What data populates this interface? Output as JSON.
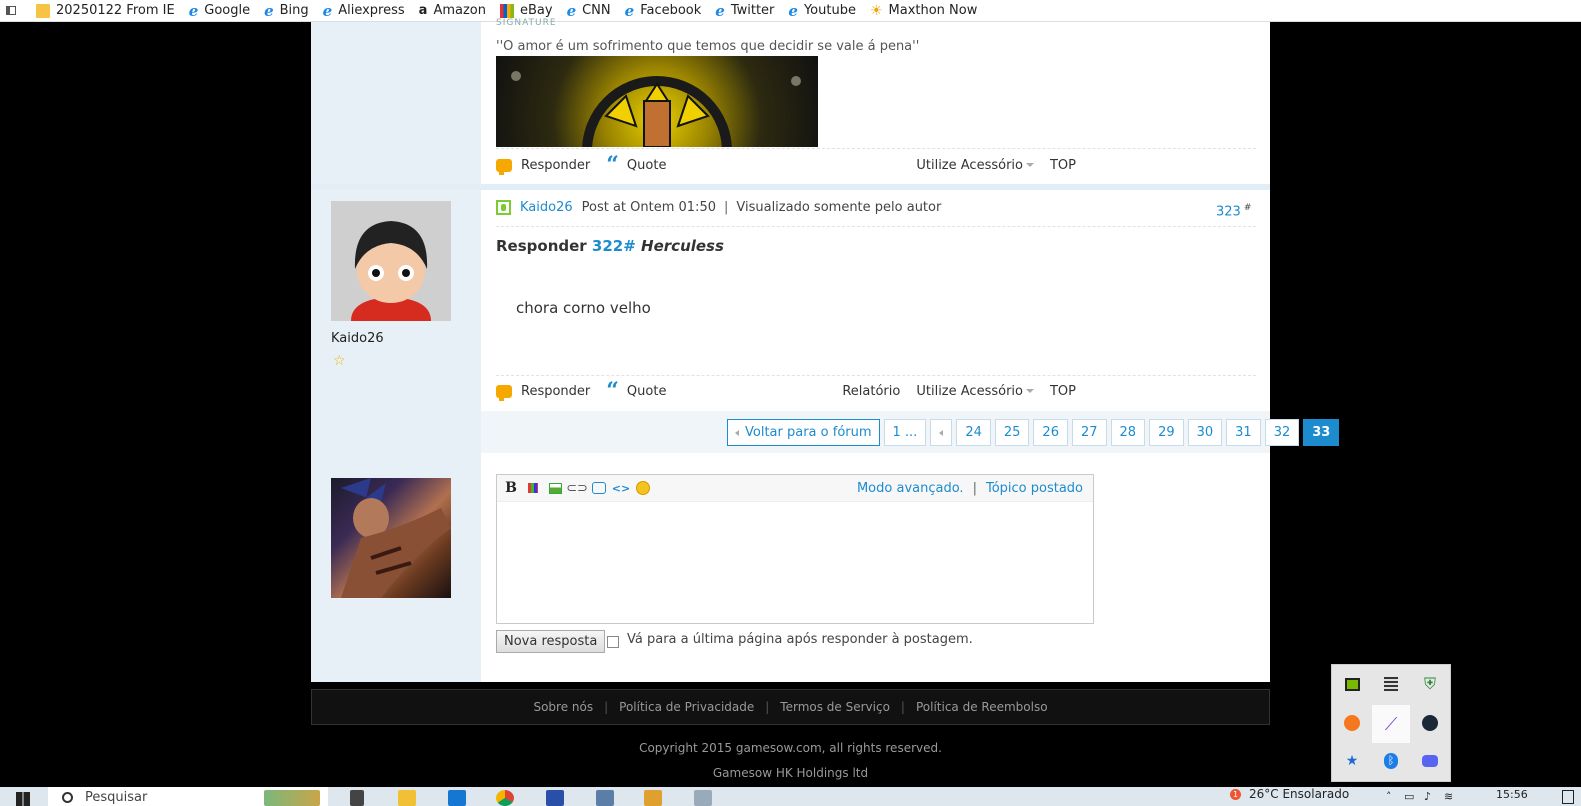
{
  "bookmarks": [
    {
      "label": "20250122 From IE",
      "icon": "folder-icon"
    },
    {
      "label": "Google",
      "icon": "ie-icon"
    },
    {
      "label": "Bing",
      "icon": "ie-icon"
    },
    {
      "label": "Aliexpress",
      "icon": "ie-icon"
    },
    {
      "label": "Amazon",
      "icon": "amazon-icon"
    },
    {
      "label": "eBay",
      "icon": "ebay-icon"
    },
    {
      "label": "CNN",
      "icon": "ie-icon"
    },
    {
      "label": "Facebook",
      "icon": "ie-icon"
    },
    {
      "label": "Twitter",
      "icon": "ie-icon"
    },
    {
      "label": "Youtube",
      "icon": "ie-icon"
    },
    {
      "label": "Maxthon Now",
      "icon": "sun-icon"
    }
  ],
  "post_prev": {
    "signature_label": "SIGNATURE",
    "signature_quote": "''O amor é um sofrimento que temos que decidir se vale á pena''",
    "actions": {
      "reply": "Responder",
      "quote": "Quote",
      "accessory": "Utilize Acessório",
      "top": "TOP"
    }
  },
  "post": {
    "author": "Kaido26",
    "header_author": "Kaido26",
    "posted_at": "Post at Ontem 01:50",
    "visibility": "Visualizado somente pelo autor",
    "number": "323",
    "number_suffix": "#",
    "reply_prefix": "Responder",
    "reply_ref": "322#",
    "reply_user": "Herculess",
    "body": "chora corno velho",
    "actions": {
      "reply": "Responder",
      "quote": "Quote",
      "report": "Relatório",
      "accessory": "Utilize Acessório",
      "top": "TOP"
    }
  },
  "pagination": {
    "back_label": "Voltar para o fórum",
    "first": "1 ...",
    "pages": [
      "24",
      "25",
      "26",
      "27",
      "28",
      "29",
      "30",
      "31",
      "32"
    ],
    "current": "33"
  },
  "editor": {
    "advanced_mode": "Modo avançado.",
    "posted_topic": "Tópico postado",
    "submit_label": "Nova resposta",
    "goto_last_label": "Vá para a última página após responder à postagem."
  },
  "footer": {
    "links": [
      "Sobre nós",
      "Política de Privacidade",
      "Termos de Serviço",
      "Política de Reembolso"
    ],
    "copyright": "Copyright 2015 gamesow.com, all rights reserved.",
    "company": "Gamesow HK Holdings ltd"
  },
  "taskbar": {
    "search_placeholder": "Pesquisar",
    "weather": "26°C  Ensolarado",
    "weather_badge": "1",
    "time": "15:56"
  },
  "colors": {
    "accent": "#1d8ccf",
    "side_bg": "#e8f0f7",
    "reply_icon": "#f5a800"
  }
}
